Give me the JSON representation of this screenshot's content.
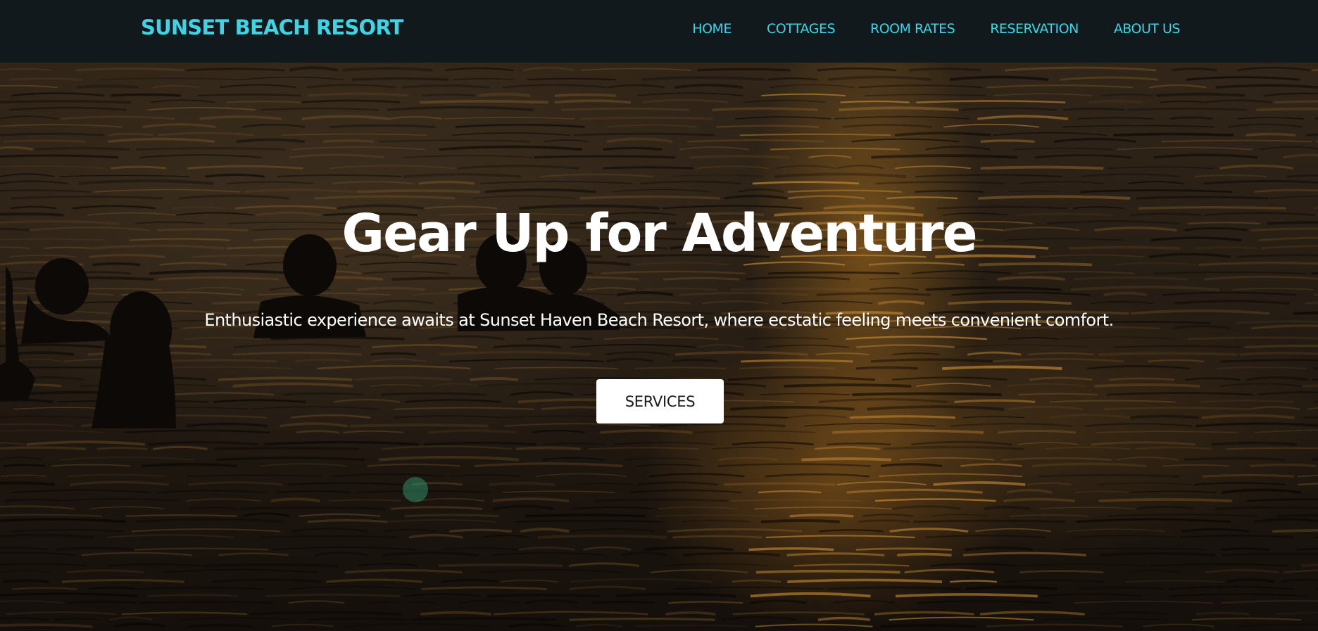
{
  "header": {
    "brand": "SUNSET BEACH RESORT",
    "nav": [
      {
        "label": "HOME"
      },
      {
        "label": "COTTAGES"
      },
      {
        "label": "ROOM RATES"
      },
      {
        "label": "RESERVATION"
      },
      {
        "label": "ABOUT US"
      }
    ]
  },
  "hero": {
    "title": "Gear Up for Adventure",
    "subtitle": "Enthusiastic experience awaits at Sunset Haven Beach Resort, where ecstatic feeling meets convenient comfort.",
    "button_label": "SERVICES"
  },
  "colors": {
    "navbar_bg": "#11191d",
    "accent": "#3fd3e6",
    "button_bg": "#ffffff",
    "hero_text": "#ffffff"
  }
}
